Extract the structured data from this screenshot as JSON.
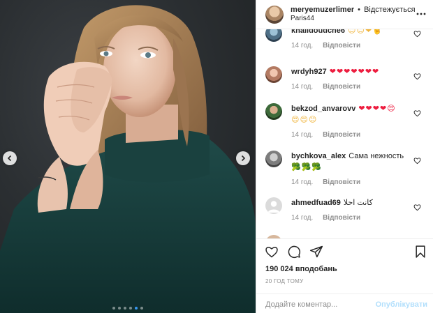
{
  "post": {
    "username": "meryemuzerlimer",
    "separator": "•",
    "follow_status": "Відстежується",
    "location": "Paris44",
    "carousel_count": 6,
    "carousel_active": 4
  },
  "comments": [
    {
      "username": "khalidoudche6",
      "text": "",
      "emoji": "😊😊❤🤘",
      "time": "14 год.",
      "reply": "Відповісти"
    },
    {
      "username": "wrdyh927",
      "text": "",
      "emoji": "❤❤❤❤❤❤❤",
      "time": "14 год.",
      "reply": "Відповісти"
    },
    {
      "username": "bekzod_anvarovv",
      "text": "",
      "emoji": "❤❤❤❤😍",
      "emoji2": "😍😍😊",
      "time": "14 год.",
      "reply": "Відповісти"
    },
    {
      "username": "bychkova_alex",
      "text": "Сама нежность",
      "emoji": "🥦🥦🥦",
      "time": "14 год.",
      "reply": "Відповісти"
    },
    {
      "username": "ahmedfuad69",
      "text": "كانت احلا",
      "emoji": "",
      "time": "14 год.",
      "reply": "Відповісти"
    }
  ],
  "actions": {
    "likes": "190 024 вподобань",
    "timestamp": "20 ГОД ТОМУ",
    "comment_placeholder": "Додайте коментар...",
    "post_label": "Опублікувати"
  },
  "icons": {
    "like": "heart-icon",
    "comment": "comment-icon",
    "share": "share-icon",
    "save": "bookmark-icon",
    "more": "more-options-icon",
    "prev": "chevron-left-icon",
    "next": "chevron-right-icon"
  },
  "colors": {
    "link_blue": "#3897f0",
    "post_disabled": "#b2dffc",
    "meta_gray": "#8e8e8e",
    "border": "#efefef"
  }
}
